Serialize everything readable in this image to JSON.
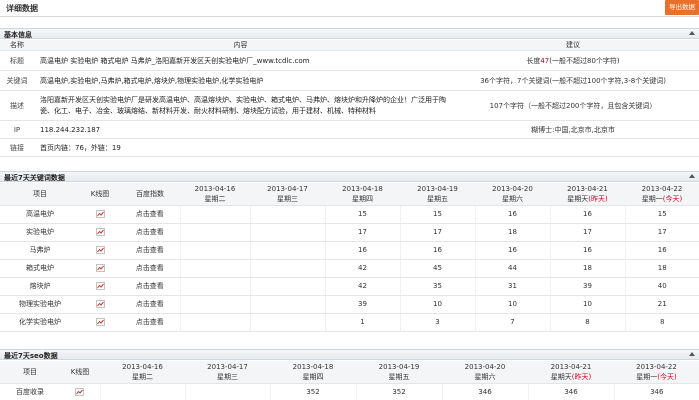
{
  "header": {
    "title": "详细数据",
    "export_label": "导出数据"
  },
  "basic": {
    "section_title": "基本信息",
    "columns": [
      "名称",
      "内容",
      "建议"
    ],
    "rows": [
      {
        "label": "标题",
        "content": "高温电炉 实验电炉 箱式电炉 马弗炉_洛阳嘉新开发区天创实验电炉厂_www.tcdlc.com",
        "sugg_prefix": "长度",
        "sugg_num": "47",
        "sugg_suffix": "(一般不超过80个字符)"
      },
      {
        "label": "关键词",
        "content": "高温电炉,实验电炉,马弗炉,箱式电炉,熔块炉,物理实验电炉,化学实验电炉",
        "sugg_prefix": "",
        "sugg_num": "",
        "sugg_suffix": "36个字符，7个关键词(一般不超过100个字符,3-8个关键词)"
      },
      {
        "label": "描述",
        "content": "洛阳嘉新开发区天创实验电炉厂是研发高温电炉、高温熔块炉、实验电炉、箱式电炉、马弗炉、熔块炉和升降炉的企业！广泛用于陶瓷、化工、电子、冶金、玻璃熔结、新材料开发、耐火材料研制、熔块配方试验，用于建材、机械、特种材料",
        "sugg_prefix": "",
        "sugg_num": "",
        "sugg_suffix": "107个字符（一般不超过200个字符，且包含关键词）"
      },
      {
        "label": "IP",
        "content": "118.244.232.187",
        "sugg_prefix": "",
        "sugg_num": "",
        "sugg_suffix": "糊博士:中国,北京市,北京市"
      },
      {
        "label": "链接",
        "content": "首页内链：76，外链：19",
        "sugg_prefix": "",
        "sugg_num": "",
        "sugg_suffix": ""
      }
    ]
  },
  "keywords7": {
    "section_title": "最近7天关键词数据",
    "col_item": "项目",
    "col_chart": "K线图",
    "col_baidu": "百度指数",
    "dates": [
      {
        "date": "2013-04-16",
        "weekday": "星期二",
        "tag": ""
      },
      {
        "date": "2013-04-17",
        "weekday": "星期三",
        "tag": ""
      },
      {
        "date": "2013-04-18",
        "weekday": "星期四",
        "tag": ""
      },
      {
        "date": "2013-04-19",
        "weekday": "星期五",
        "tag": ""
      },
      {
        "date": "2013-04-20",
        "weekday": "星期六",
        "tag": ""
      },
      {
        "date": "2013-04-21",
        "weekday": "星期天",
        "tag": "(昨天)"
      },
      {
        "date": "2013-04-22",
        "weekday": "星期一",
        "tag": "(今天)"
      }
    ],
    "rows": [
      {
        "item": "高温电炉",
        "baidu": "点击查看",
        "values": [
          "",
          "",
          "15",
          "15",
          "16",
          "16",
          "15"
        ]
      },
      {
        "item": "实验电炉",
        "baidu": "点击查看",
        "values": [
          "",
          "",
          "17",
          "17",
          "18",
          "17",
          "17"
        ]
      },
      {
        "item": "马弗炉",
        "baidu": "点击查看",
        "values": [
          "",
          "",
          "16",
          "16",
          "16",
          "16",
          "16"
        ]
      },
      {
        "item": "箱式电炉",
        "baidu": "点击查看",
        "values": [
          "",
          "",
          "42",
          "45",
          "44",
          "18",
          "18"
        ]
      },
      {
        "item": "熔块炉",
        "baidu": "点击查看",
        "values": [
          "",
          "",
          "42",
          "35",
          "31",
          "39",
          "40"
        ]
      },
      {
        "item": "物理实验电炉",
        "baidu": "点击查看",
        "values": [
          "",
          "",
          "39",
          "10",
          "10",
          "10",
          "21"
        ]
      },
      {
        "item": "化学实验电炉",
        "baidu": "点击查看",
        "values": [
          "",
          "",
          "1",
          "3",
          "7",
          "8",
          "8"
        ]
      }
    ]
  },
  "seo7": {
    "section_title": "最近7天seo数据",
    "col_item": "项目",
    "col_chart": "K线图",
    "dates": [
      {
        "date": "2013-04-16",
        "weekday": "星期二",
        "tag": ""
      },
      {
        "date": "2013-04-17",
        "weekday": "星期三",
        "tag": ""
      },
      {
        "date": "2013-04-18",
        "weekday": "星期四",
        "tag": ""
      },
      {
        "date": "2013-04-19",
        "weekday": "星期五",
        "tag": ""
      },
      {
        "date": "2013-04-20",
        "weekday": "星期六",
        "tag": ""
      },
      {
        "date": "2013-04-21",
        "weekday": "星期天",
        "tag": "(昨天)"
      },
      {
        "date": "2013-04-22",
        "weekday": "星期一",
        "tag": "(今天)"
      }
    ],
    "rows": [
      {
        "item": "百度收录",
        "values": [
          "",
          "",
          "352",
          "352",
          "346",
          "346",
          "346"
        ]
      }
    ]
  },
  "colors": {
    "accent": "#e8702a",
    "highlight": "#d0021b",
    "chart_icon": "#c0392b"
  },
  "icons": {
    "chart": "kline-chart-icon",
    "collapse": "collapse-caret-icon"
  }
}
